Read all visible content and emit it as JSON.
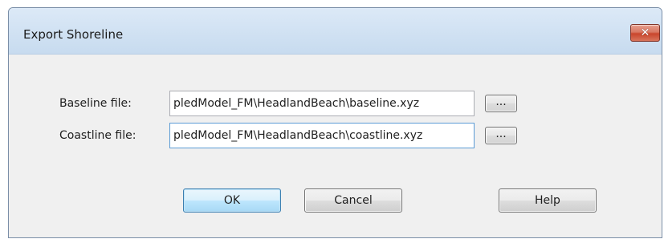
{
  "window": {
    "title": "Export Shoreline",
    "close_glyph": "✕"
  },
  "fields": {
    "baseline": {
      "label": "Baseline file:",
      "value": "pledModel_FM\\HeadlandBeach\\baseline.xyz",
      "browse_label": "..."
    },
    "coastline": {
      "label": "Coastline file:",
      "value": "pledModel_FM\\HeadlandBeach\\coastline.xyz",
      "browse_label": "..."
    }
  },
  "buttons": {
    "ok_label": "OK",
    "cancel_label": "Cancel",
    "help_label": "Help"
  },
  "colors": {
    "titlebar": "#c7dbef",
    "close_button": "#c9452c",
    "focus_border": "#5b9bd5",
    "default_button": "#bee6fd"
  }
}
